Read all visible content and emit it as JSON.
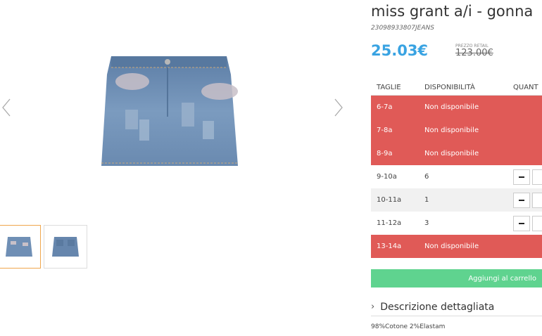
{
  "product": {
    "title": "miss grant a/i - gonna",
    "sku": "23098933807JEANS",
    "price": "25.03€",
    "retail_label": "PREZZO RETAIL",
    "retail_price": "123.00€"
  },
  "sizes_table": {
    "headers": {
      "size": "TAGLIE",
      "availability": "DISPONIBILITÀ",
      "quantity": "QUANT"
    },
    "rows": [
      {
        "size": "6-7a",
        "availability": "Non disponibile",
        "available": false
      },
      {
        "size": "7-8a",
        "availability": "Non disponibile",
        "available": false
      },
      {
        "size": "8-9a",
        "availability": "Non disponibile",
        "available": false
      },
      {
        "size": "9-10a",
        "availability": "6",
        "available": true
      },
      {
        "size": "10-11a",
        "availability": "1",
        "available": true
      },
      {
        "size": "11-12a",
        "availability": "3",
        "available": true
      },
      {
        "size": "13-14a",
        "availability": "Non disponibile",
        "available": false
      }
    ]
  },
  "actions": {
    "add_to_cart": "Aggiungi al carrello"
  },
  "description": {
    "toggle_label": "Descrizione dettagliata",
    "composition": "98%Cotone 2%Elastam"
  },
  "colors": {
    "unavailable": "#e05a57",
    "add_to_cart": "#5fd38f",
    "price": "#39a3e2",
    "thumb_active": "#f0a64c"
  },
  "icons": {
    "prev": "chevron-left-icon",
    "next": "chevron-right-icon",
    "minus": "minus-icon",
    "expand": "chevron-right-icon"
  }
}
